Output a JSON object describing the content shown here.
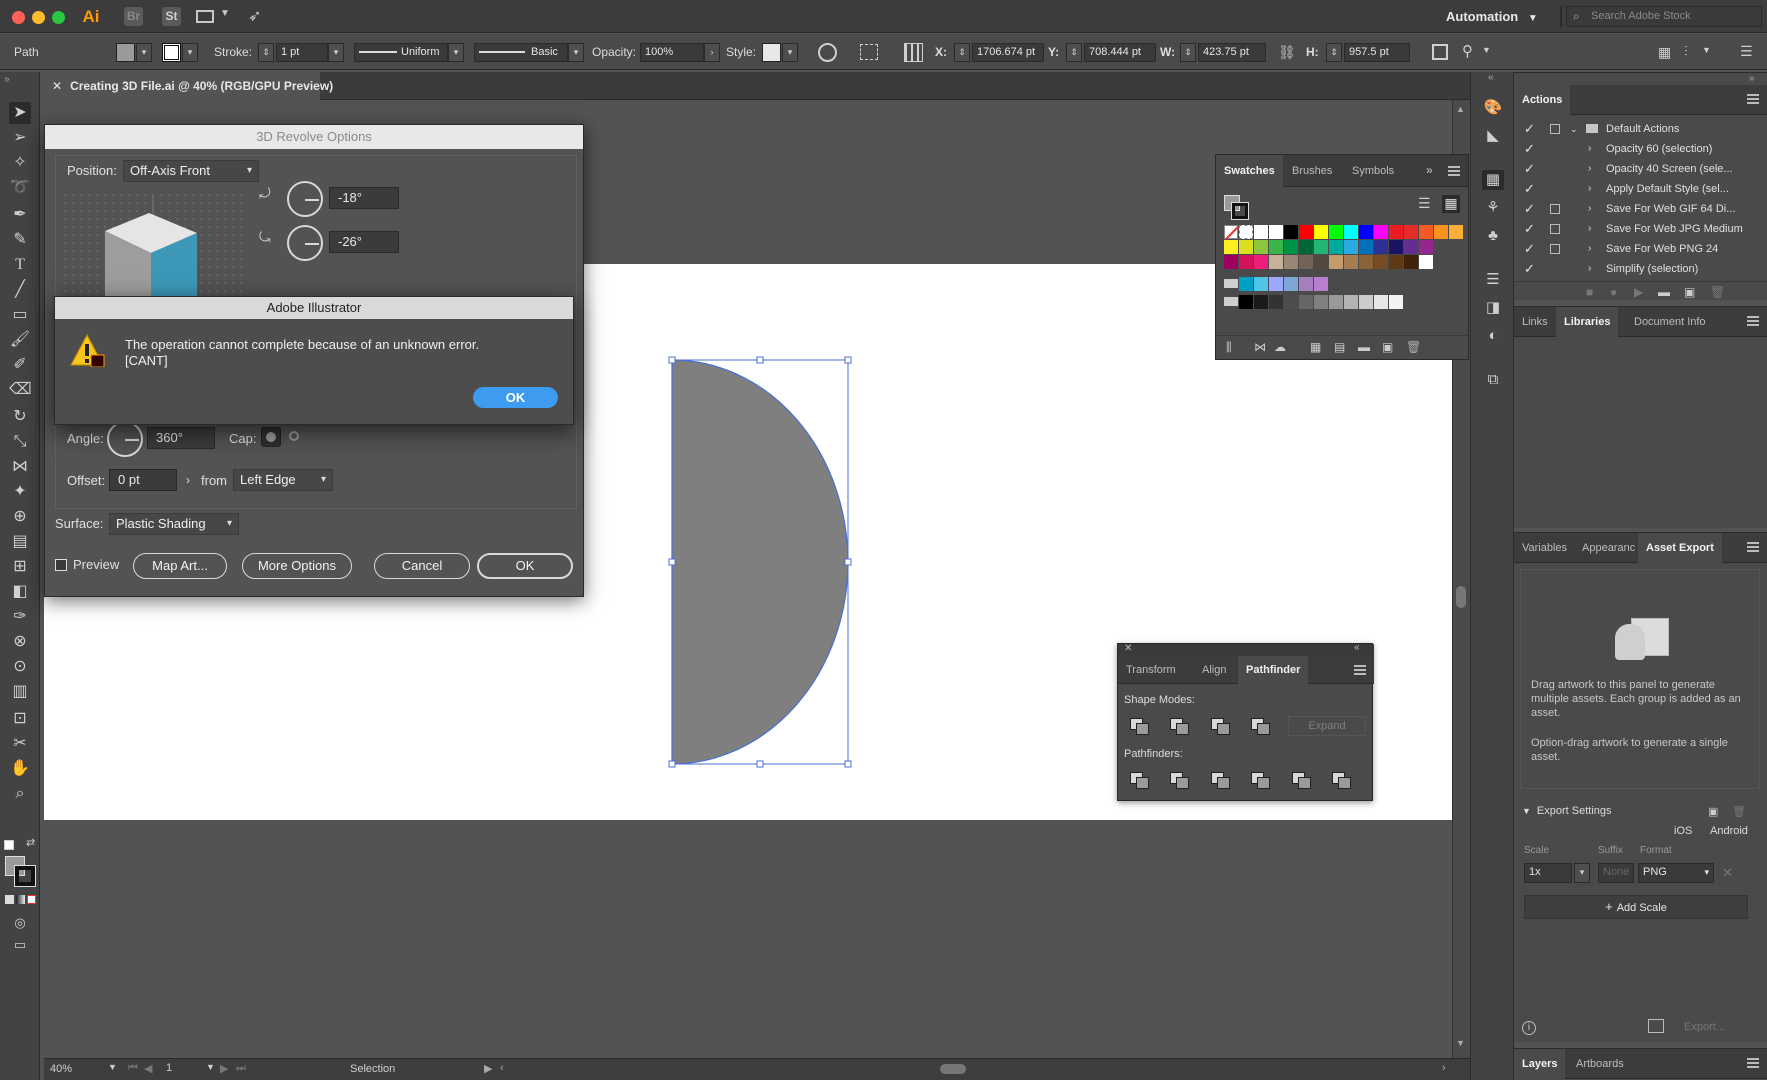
{
  "app": {
    "workspace": "Automation",
    "search_placeholder": "Search Adobe Stock",
    "app_icons": [
      "Ai",
      "Br",
      "St"
    ]
  },
  "control_bar": {
    "object_type": "Path",
    "stroke_label": "Stroke:",
    "stroke_weight": "1 pt",
    "profile": "Uniform",
    "brush": "Basic",
    "opacity_label": "Opacity:",
    "opacity": "100%",
    "style_label": "Style:",
    "x_label": "X:",
    "x": "1706.674 pt",
    "y_label": "Y:",
    "y": "708.444 pt",
    "w_label": "W:",
    "w": "423.75 pt",
    "h_label": "H:",
    "h": "957.5 pt"
  },
  "document": {
    "tab_title": "Creating 3D File.ai @ 40% (RGB/GPU Preview)"
  },
  "status_bar": {
    "zoom": "40%",
    "artboard": "1",
    "tool": "Selection"
  },
  "revolve_dialog": {
    "title": "3D Revolve Options",
    "position_label": "Position:",
    "position": "Off-Axis Front",
    "rotation_x": "-18°",
    "rotation_y": "-26°",
    "angle_label": "Angle:",
    "angle": "360°",
    "cap_label": "Cap:",
    "offset_label": "Offset:",
    "offset": "0 pt",
    "from_label": "from",
    "from": "Left Edge",
    "surface_label": "Surface:",
    "surface": "Plastic Shading",
    "preview_label": "Preview",
    "map_art": "Map Art...",
    "more_options": "More Options",
    "cancel": "Cancel",
    "ok": "OK"
  },
  "alert": {
    "title": "Adobe Illustrator",
    "message": "The operation cannot complete because of an unknown error.",
    "code": "[CANT]",
    "ok": "OK"
  },
  "swatches_panel": {
    "tabs": [
      "Swatches",
      "Brushes",
      "Symbols"
    ],
    "rows": [
      [
        "#ffffff",
        "#ffffff",
        "#000000",
        "#ff0000",
        "#ffff00",
        "#00ff00",
        "#00ffff",
        "#0000ff",
        "#ff00ff",
        "#ec1c24",
        "#e22d2a",
        "#f15a24",
        "#f7931e",
        "#fbb03b"
      ],
      [
        "#fcee21",
        "#d9e021",
        "#8cc63f",
        "#39b54a",
        "#009245",
        "#006837",
        "#22b573",
        "#00a99d",
        "#29abe2",
        "#0071bc",
        "#2e3192",
        "#1b1464",
        "#662d91",
        "#93278f"
      ],
      [
        "#9e005d",
        "#d4145a",
        "#ed1e79",
        "#c7b299",
        "#998675",
        "#736357",
        "#534741",
        "#c69c6d",
        "#a67c52",
        "#8c6239",
        "#754c24",
        "#603813",
        "#42210b",
        "#ffffff"
      ],
      [
        "#00a0c6",
        "#4fc3e8",
        "#9aa8ff",
        "#7ea7d8",
        "#a57fc0",
        "#b87fd1"
      ],
      [
        "#000000",
        "#1a1a1a",
        "#333333",
        "#4d4d4d",
        "#666666",
        "#808080",
        "#999999",
        "#b3b3b3",
        "#cccccc",
        "#e6e6e6",
        "#f2f2f2"
      ]
    ]
  },
  "actions_panel": {
    "title": "Actions",
    "set": "Default Actions",
    "items": [
      "Opacity 60 (selection)",
      "Opacity 40 Screen (sele...",
      "Apply Default Style (sel...",
      "Save For Web GIF 64 Di...",
      "Save For Web JPG Medium",
      "Save For Web PNG 24",
      "Simplify (selection)"
    ]
  },
  "links_panel": {
    "tabs": [
      "Links",
      "Libraries",
      "Document Info"
    ]
  },
  "asset_panel": {
    "tabs": [
      "Variables",
      "Appearanc",
      "Asset Export"
    ],
    "drag_text": "Drag artwork to this panel to generate multiple assets. Each group is added as an asset.",
    "option_text": "Option-drag artwork to generate a single asset.",
    "export_settings": "Export Settings",
    "ios": "iOS",
    "android": "Android",
    "scale_label": "Scale",
    "suffix_label": "Suffix",
    "format_label": "Format",
    "scale": "1x",
    "suffix_placeholder": "None",
    "format": "PNG",
    "add_scale": "Add Scale",
    "export": "Export..."
  },
  "layers_panel": {
    "tabs": [
      "Layers",
      "Artboards"
    ]
  },
  "pathfinder_panel": {
    "tabs": [
      "Transform",
      "Align",
      "Pathfinder"
    ],
    "shape_modes": "Shape Modes:",
    "expand": "Expand",
    "pathfinders": "Pathfinders:"
  },
  "colors": {
    "selection": "#4a6fd6",
    "shape_fill": "#7f7f7f",
    "cube_top": "#e5e5e5",
    "cube_left": "#9d9d9d",
    "cube_right": "#3d98b8",
    "alert_ok": "#3d9bf0"
  }
}
